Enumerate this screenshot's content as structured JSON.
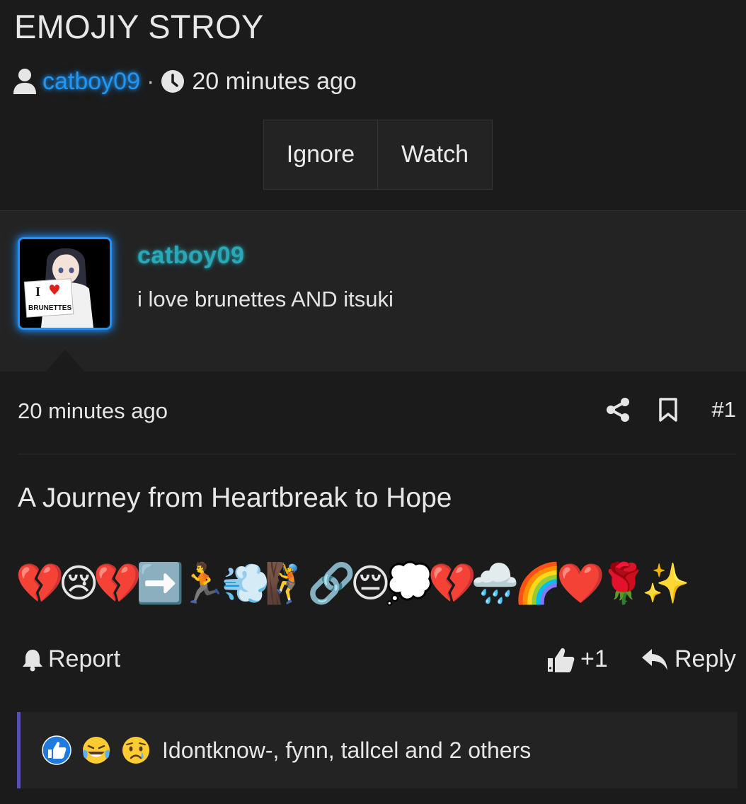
{
  "thread": {
    "title": "EMOJIY STROY",
    "author": "catboy09",
    "separator": "·",
    "time": "20 minutes ago",
    "buttons": {
      "ignore": "Ignore",
      "watch": "Watch"
    }
  },
  "author_block": {
    "name": "catboy09",
    "bio": "i love brunettes AND itsuki",
    "avatar_sign_text": "I ❤ BRUNETTES",
    "avatar_sign_line1": "I",
    "avatar_sign_line2": "BRUNETTES"
  },
  "post": {
    "time": "20 minutes ago",
    "number": "#1",
    "heading": "A Journey from Heartbreak to Hope",
    "emoji_text": "💔😢💔➡️🏃💨🧗🔗😔💭💔🌧️🌈❤️🌹✨",
    "footer": {
      "report": "Report",
      "like_count": "+1",
      "reply": "Reply"
    },
    "reactions_text": "Idontknow-, fynn, tallcel and 2 others"
  },
  "colors": {
    "background": "#1b1b1b",
    "panel": "#232323",
    "author_link": "#2196f3",
    "username_glow": "#29a9b8",
    "reaction_accent": "#5650a8"
  },
  "icons": [
    "user-icon",
    "clock-icon",
    "share-icon",
    "bookmark-icon",
    "bell-icon",
    "thumbs-up-icon",
    "reply-arrow-icon",
    "like-reaction-icon",
    "laughing-crying-reaction-icon",
    "sad-reaction-icon"
  ]
}
